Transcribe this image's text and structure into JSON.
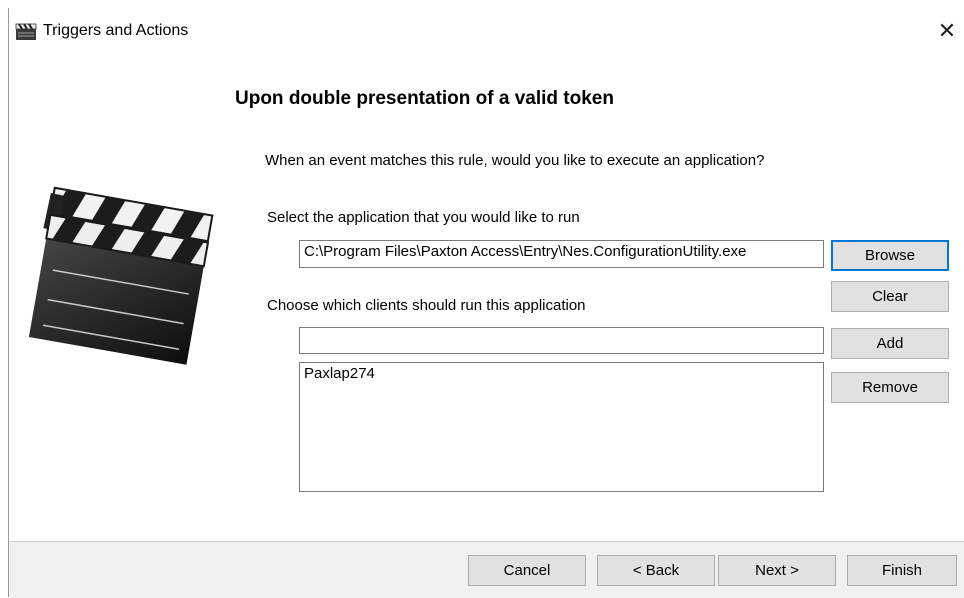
{
  "window": {
    "title": "Triggers and Actions",
    "close_glyph": "✕"
  },
  "page": {
    "heading": "Upon double presentation of a valid token",
    "question": "When an event matches this rule, would you like to execute an application?",
    "select_label": "Select the application that you would like to run",
    "clients_label": "Choose which clients should run this application"
  },
  "app_path": {
    "value": "C:\\Program Files\\Paxton Access\\Entry\\Nes.ConfigurationUtility.exe"
  },
  "client_input": {
    "value": ""
  },
  "clients": {
    "items": [
      "Paxlap274"
    ]
  },
  "buttons": {
    "browse": "Browse",
    "clear": "Clear",
    "add": "Add",
    "remove": "Remove",
    "cancel": "Cancel",
    "back": "< Back",
    "next": "Next >",
    "finish": "Finish"
  },
  "colors": {
    "accent": "#0078d7",
    "footer_bg": "#f0f0f0",
    "button_bg": "#e1e1e1"
  },
  "icons": {
    "app": "clapperboard-icon",
    "hero": "clapperboard-icon",
    "close": "close-icon"
  }
}
